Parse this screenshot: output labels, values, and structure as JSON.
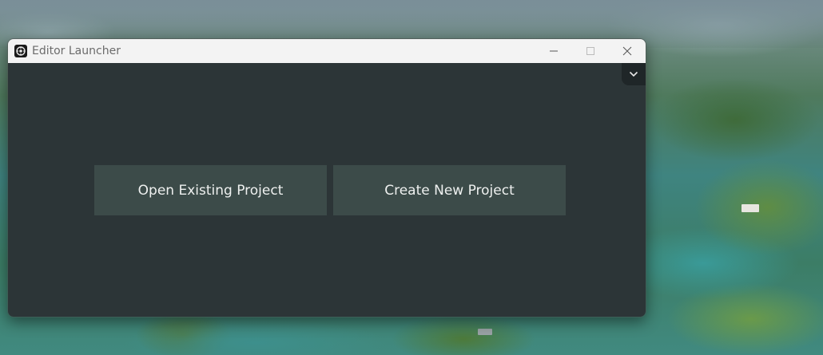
{
  "window": {
    "title": "Editor Launcher",
    "icons": {
      "app": "editor-logo-icon",
      "minimize": "minimize-icon",
      "maximize": "maximize-icon",
      "close": "close-icon"
    }
  },
  "content": {
    "menu_toggle_icon": "chevron-down-icon",
    "buttons": {
      "open_existing": "Open Existing Project",
      "create_new": "Create New Project"
    }
  },
  "colors": {
    "content_background": "#2c3537",
    "button_background": "#3c4b49",
    "button_text": "#eef0ef",
    "titlebar_background": "#f3f3f3",
    "toggle_background": "#1f2628"
  }
}
